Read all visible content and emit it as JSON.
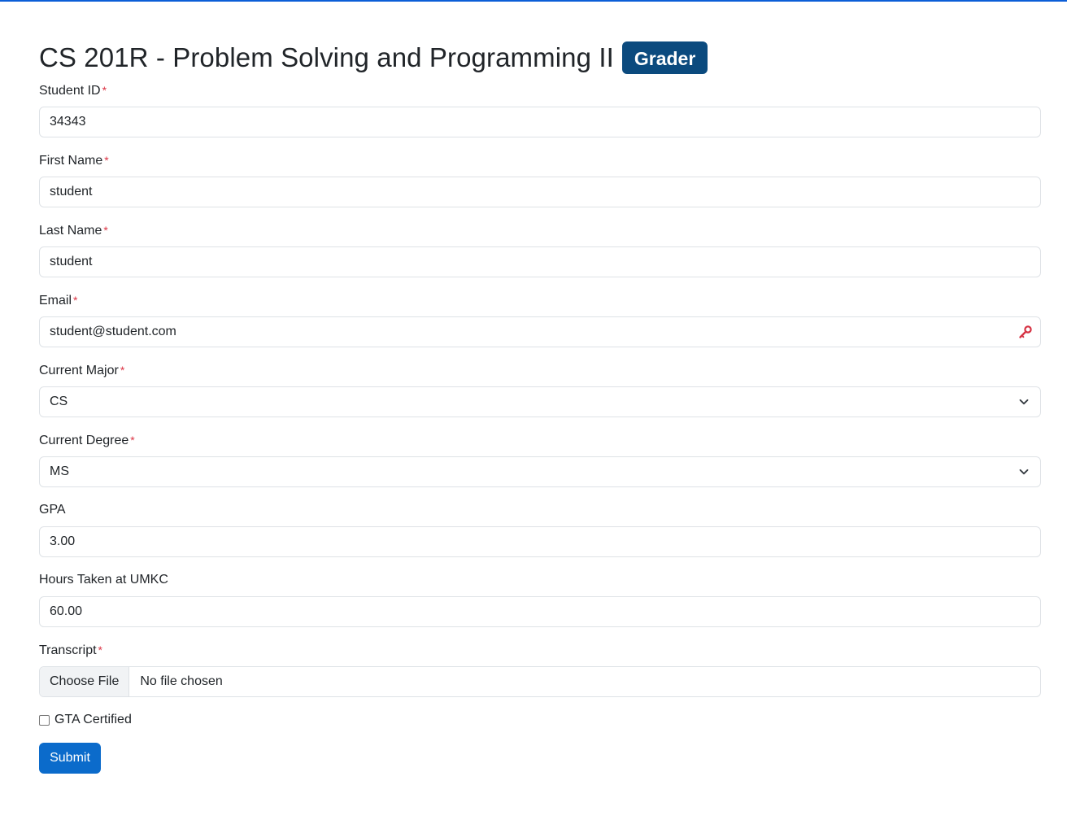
{
  "header": {
    "title": "CS 201R - Problem Solving and Programming II",
    "badge": "Grader"
  },
  "form": {
    "required_marker": "*",
    "student_id": {
      "label": "Student ID",
      "value": "34343"
    },
    "first_name": {
      "label": "First Name",
      "value": "student"
    },
    "last_name": {
      "label": "Last Name",
      "value": "student"
    },
    "email": {
      "label": "Email",
      "value": "student@student.com",
      "icon": "key-icon"
    },
    "current_major": {
      "label": "Current Major",
      "selected": "CS"
    },
    "current_degree": {
      "label": "Current Degree",
      "selected": "MS"
    },
    "gpa": {
      "label": "GPA",
      "value": "3.00"
    },
    "hours": {
      "label": "Hours Taken at UMKC",
      "value": "60.00"
    },
    "transcript": {
      "label": "Transcript",
      "button": "Choose File",
      "status": "No file chosen"
    },
    "gta_certified": {
      "label": "GTA Certified",
      "checked": false
    },
    "submit_label": "Submit"
  },
  "colors": {
    "accent": "#0b5ed7",
    "badge": "#0b4a7e",
    "submit": "#0b6bcb",
    "required": "#dc3545"
  }
}
